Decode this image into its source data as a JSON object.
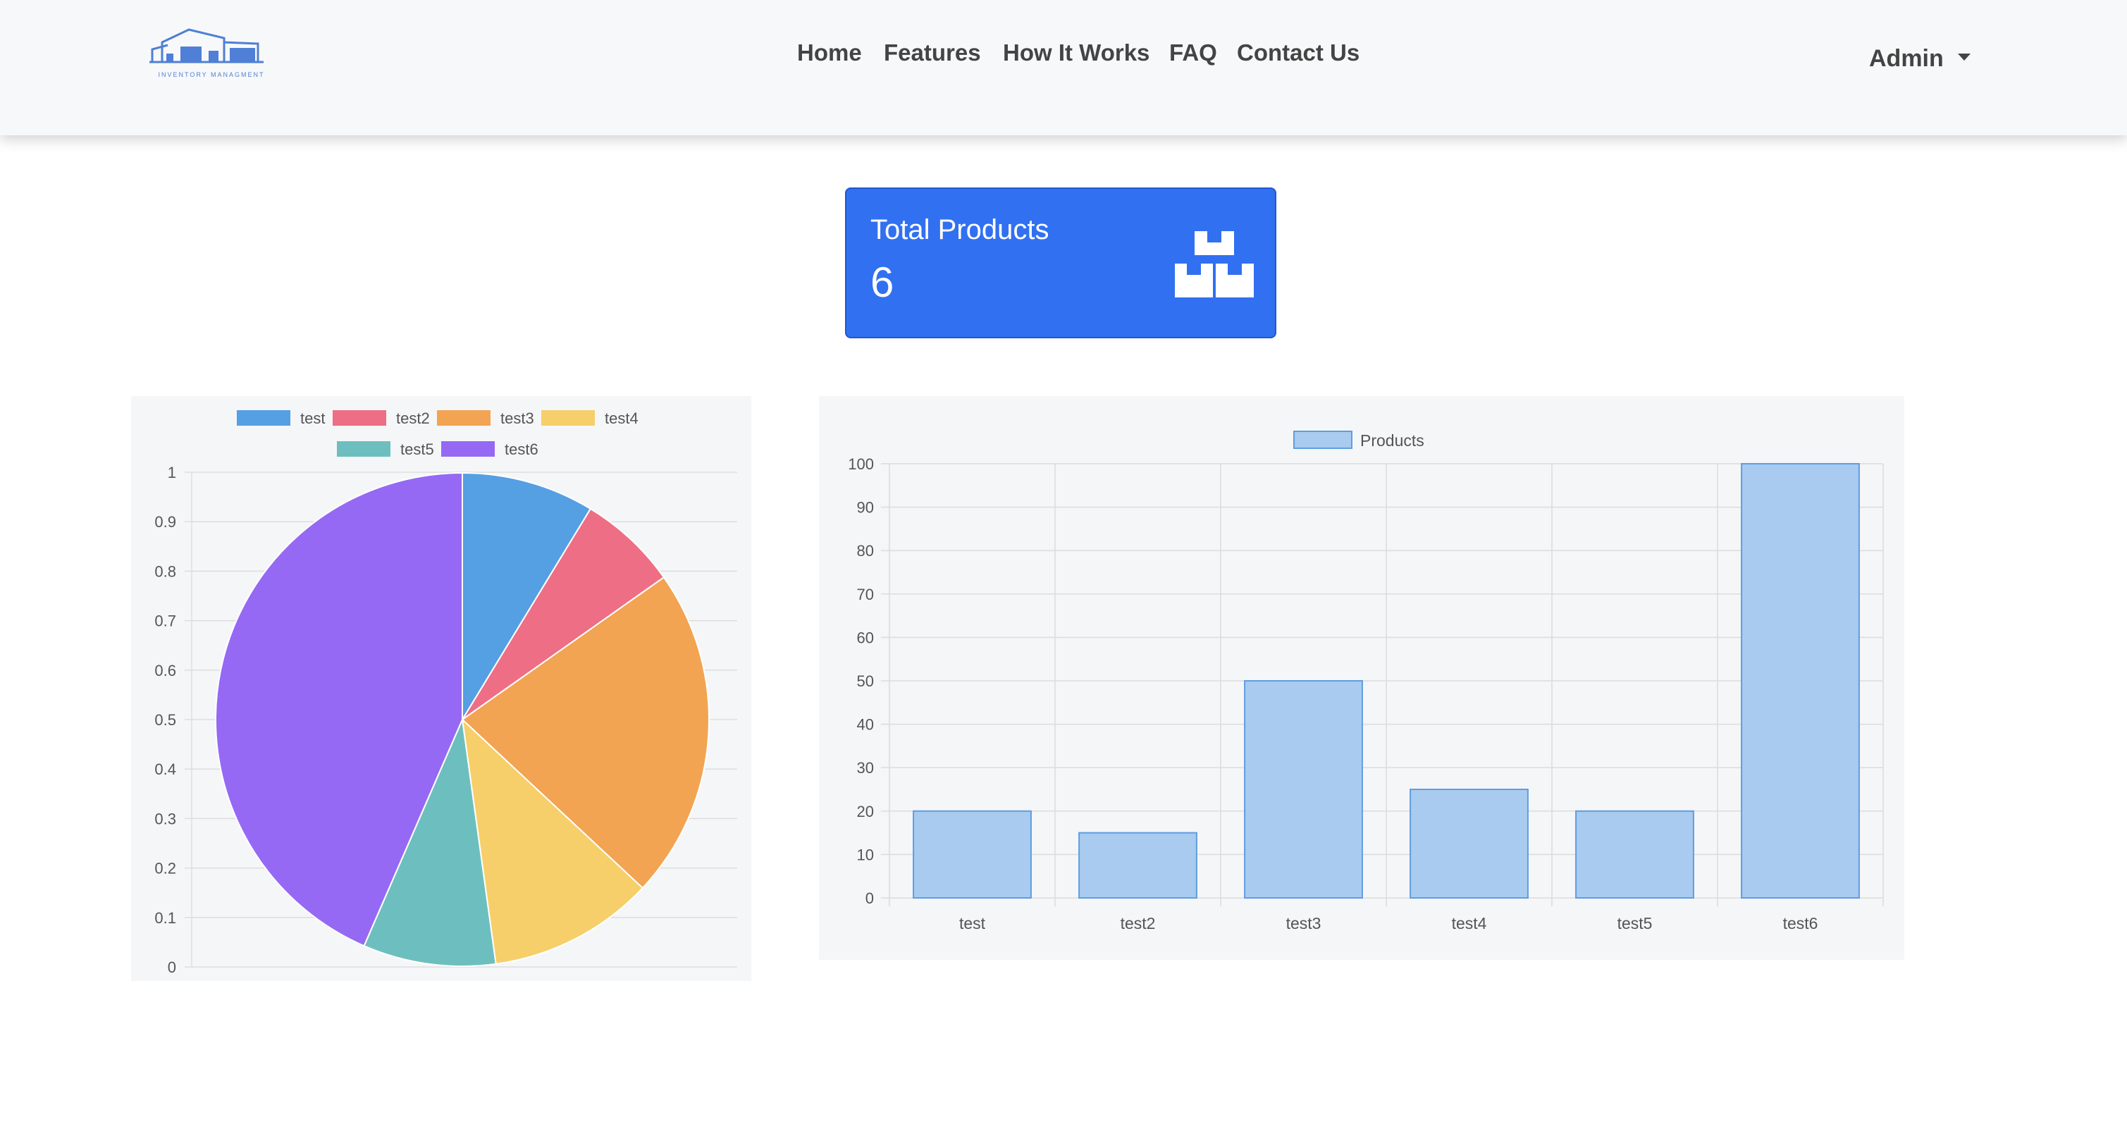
{
  "header": {
    "logo_text": "INVENTORY MANAGMENT",
    "nav": [
      "Home",
      "Features",
      "How It Works",
      "FAQ",
      "Contact Us"
    ],
    "user_menu_label": "Admin"
  },
  "summary_card": {
    "title": "Total Products",
    "value": "6",
    "icon": "boxes-icon",
    "color": "#3170f1"
  },
  "chart_data": [
    {
      "type": "pie",
      "legend_position": "top",
      "labels": [
        "test",
        "test2",
        "test3",
        "test4",
        "test5",
        "test6"
      ],
      "values": [
        20,
        15,
        50,
        25,
        20,
        100
      ],
      "colors": [
        "#559fe3",
        "#ee6e85",
        "#f2a452",
        "#f6cf6b",
        "#6dbfbf",
        "#9569f4"
      ],
      "ylim": [
        0,
        1
      ],
      "yticks": [
        "0",
        "0.1",
        "0.2",
        "0.3",
        "0.4",
        "0.5",
        "0.6",
        "0.7",
        "0.8",
        "0.9",
        "1"
      ],
      "grid": true
    },
    {
      "type": "bar",
      "legend_position": "top",
      "categories": [
        "test",
        "test2",
        "test3",
        "test4",
        "test5",
        "test6"
      ],
      "series": [
        {
          "name": "Products",
          "values": [
            20,
            15,
            50,
            25,
            20,
            100
          ]
        }
      ],
      "ylim": [
        0,
        100
      ],
      "yticks": [
        "0",
        "10",
        "20",
        "30",
        "40",
        "50",
        "60",
        "70",
        "80",
        "90",
        "100"
      ],
      "grid": true,
      "bar_color": "#a9cbef",
      "bar_border": "#5f9de0"
    }
  ]
}
